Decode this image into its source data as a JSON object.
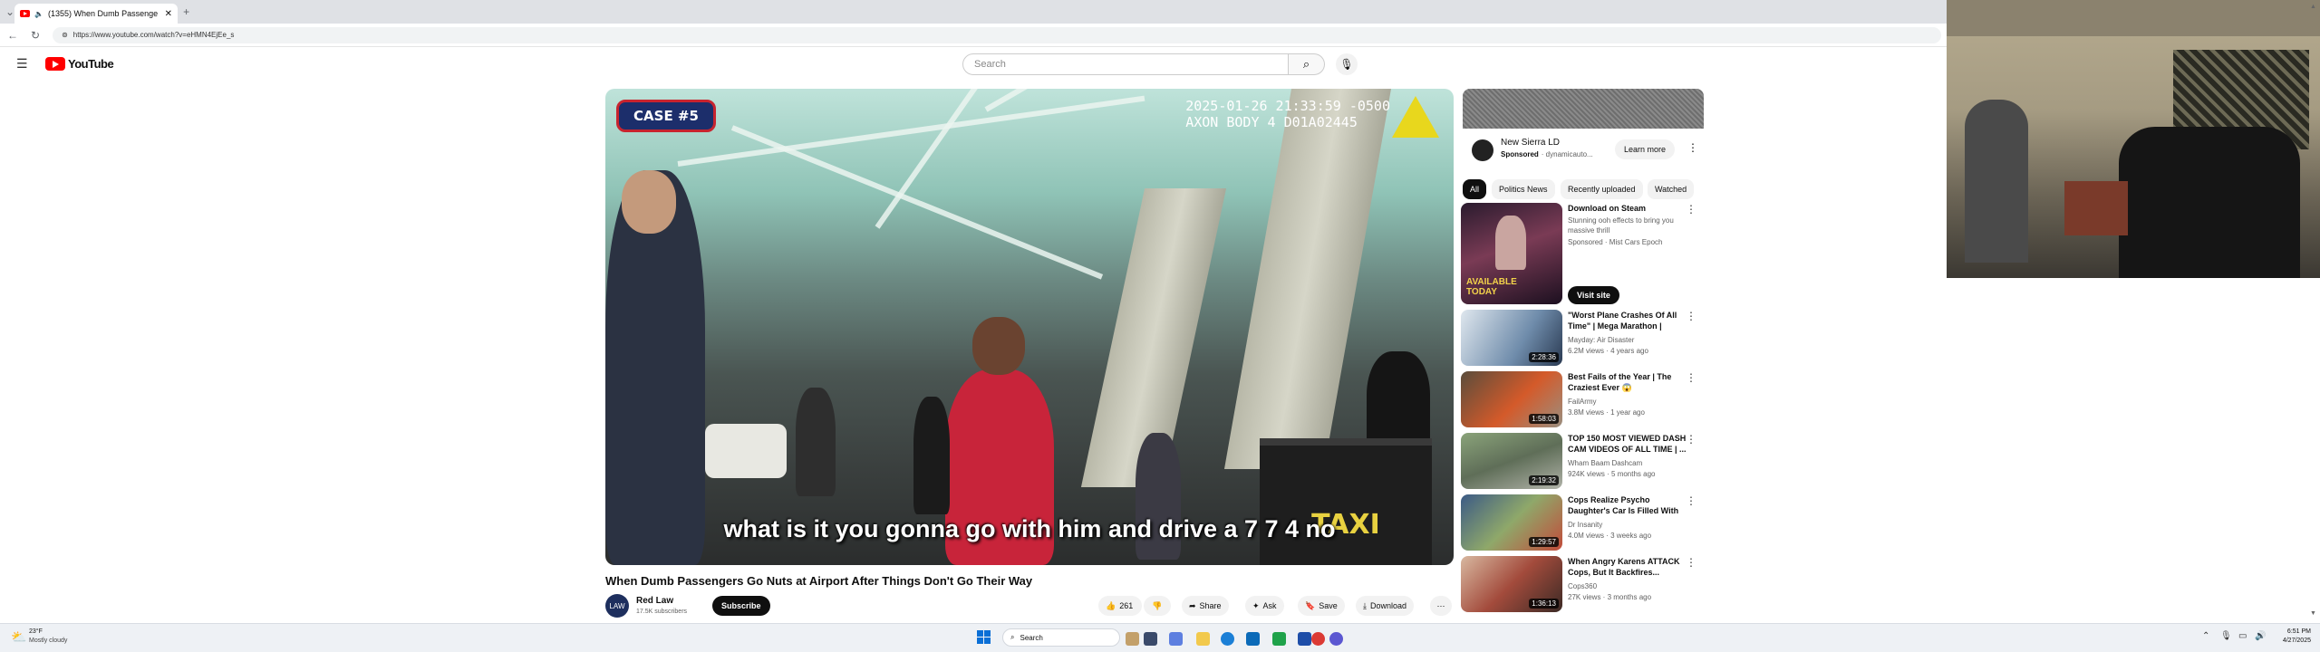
{
  "browser": {
    "tab_title": "(1355) When Dumb Passenge",
    "url": "https://www.youtube.com/watch?v=eHMN4EjEe_s"
  },
  "header": {
    "logo_text": "YouTube",
    "search_placeholder": "Search"
  },
  "video": {
    "case_badge": "CASE #5",
    "timestamp_line1": "2025-01-26 21:33:59 -0500",
    "timestamp_line2": "AXON BODY 4 D01A02445",
    "subtitle": "what is it you gonna go with him and drive a 7 7 4 no",
    "sign_text": "TAXI",
    "title": "When Dumb Passengers Go Nuts at Airport After Things Don't Go Their Way"
  },
  "channel": {
    "avatar_text": "LAW",
    "name": "Red Law",
    "subscribers": "17.5K subscribers",
    "subscribe_label": "Subscribe"
  },
  "actions": {
    "likes": "261",
    "share": "Share",
    "ask": "Ask",
    "save": "Save",
    "download": "Download"
  },
  "ad": {
    "name": "New Sierra LD",
    "sponsored": "Sponsored",
    "domain": "· dynamicauto...",
    "learn_more": "Learn more"
  },
  "chips": [
    "All",
    "Politics News",
    "Recently uploaded",
    "Watched"
  ],
  "recommendations": [
    {
      "title": "Download on Steam",
      "line2": "Stunning ooh effects to bring you massive thrill",
      "line3": "Sponsored · Mist Cars Epoch",
      "duration": "",
      "thumb_text": "AVAILABLE TODAY",
      "button": "Visit site"
    },
    {
      "title": "\"Worst Plane Crashes Of All Time\" | Mega Marathon | FULL...",
      "line2": "Mayday: Air Disaster",
      "line3": "6.2M views · 4 years ago",
      "duration": "2:28:36"
    },
    {
      "title": "Best Fails of the Year | The Craziest Ever 😱",
      "line2": "FailArmy",
      "line3": "3.8M views · 1 year ago",
      "duration": "1:58:03"
    },
    {
      "title": "TOP 150 MOST VIEWED DASH CAM VIDEOS OF ALL TIME | ...",
      "line2": "Wham Baam Dashcam",
      "line3": "924K views · 5 months ago",
      "duration": "2:19:32"
    },
    {
      "title": "Cops Realize Psycho Daughter's Car Is Filled With Bodies",
      "line2": "Dr Insanity",
      "line3": "4.0M views · 3 weeks ago",
      "duration": "1:29:57"
    },
    {
      "title": "When Angry Karens ATTACK Cops, But It Backfires...",
      "line2": "Cops360",
      "line3": "27K views · 3 months ago",
      "duration": "1:36:13"
    }
  ],
  "taskbar": {
    "weather_temp": "23°F",
    "weather_desc": "Mostly cloudy",
    "search": "Search",
    "time": "6:51 PM",
    "date": "4/27/2025"
  }
}
